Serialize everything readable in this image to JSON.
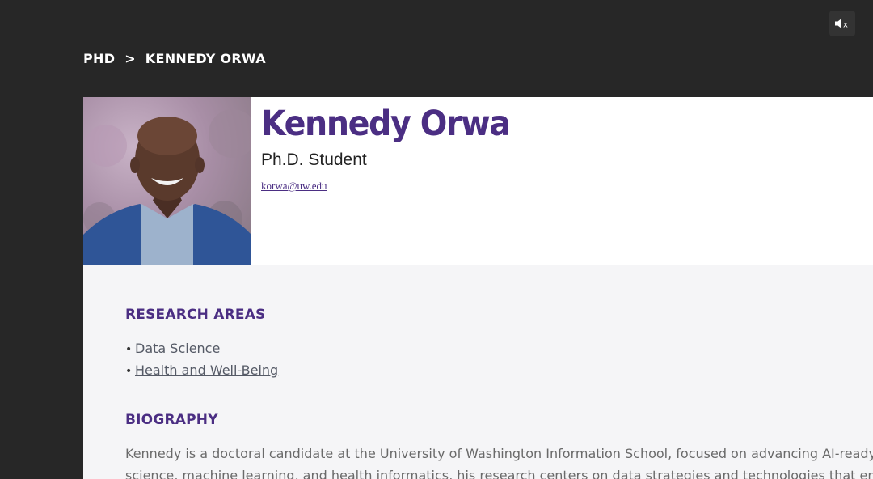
{
  "controls": {
    "mute_icon_label": "x"
  },
  "breadcrumb": {
    "items": [
      "PHD",
      "KENNEDY ORWA"
    ],
    "separator": ">"
  },
  "profile": {
    "name": "Kennedy Orwa",
    "title": "Ph.D. Student",
    "email": "korwa@uw.edu"
  },
  "research_areas": {
    "heading": "RESEARCH AREAS",
    "items": [
      "Data Science",
      "Health and Well-Being"
    ]
  },
  "biography": {
    "heading": "BIOGRAPHY",
    "lines": [
      "Kennedy is a doctoral candidate at the University of Washington Information School, focused on advancing AI-ready hea",
      "science, machine learning, and health informatics, his research centers on data strategies and technologies that enable"
    ]
  },
  "colors": {
    "background": "#272727",
    "brand_purple": "#4b2e83",
    "content_bg": "#f5f5f7"
  }
}
